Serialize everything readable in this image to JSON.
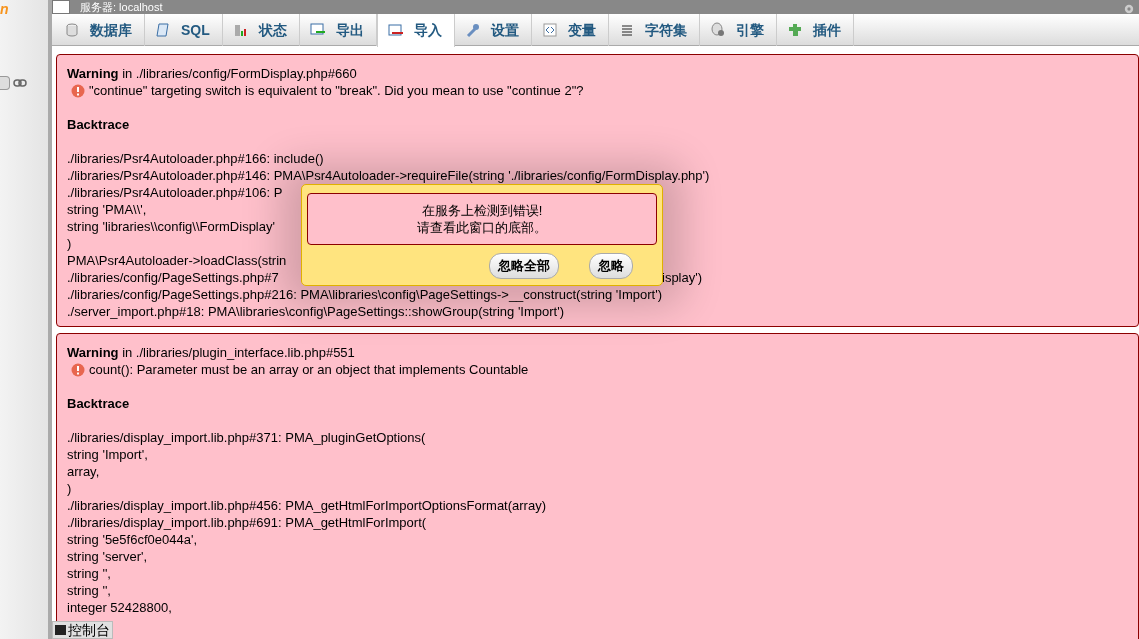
{
  "sidebar": {
    "logo_text": "n"
  },
  "window": {
    "title": "服务器: localhost"
  },
  "tabs": [
    {
      "label": "数据库",
      "selected": false
    },
    {
      "label": "SQL",
      "selected": false
    },
    {
      "label": "状态",
      "selected": false
    },
    {
      "label": "导出",
      "selected": false
    },
    {
      "label": "导入",
      "selected": true
    },
    {
      "label": "设置",
      "selected": false
    },
    {
      "label": "变量",
      "selected": false
    },
    {
      "label": "字符集",
      "selected": false
    },
    {
      "label": "引擎",
      "selected": false
    },
    {
      "label": "插件",
      "selected": false
    }
  ],
  "errors": [
    {
      "level": "Warning",
      "location": "in ./libraries/config/FormDisplay.php#660",
      "message": "\"continue\" targeting switch is equivalent to \"break\". Did you mean to use \"continue 2\"?",
      "backtrace_title": "Backtrace",
      "backtrace": [
        {
          "text": "./libraries/Psr4Autoloader.php#166: include()"
        },
        {
          "text": "./libraries/Psr4Autoloader.php#146: PMA\\Psr4Autoloader->requireFile(string './libraries/config/FormDisplay.php')"
        },
        {
          "text": "./libraries/Psr4Autoloader.php#106: P"
        },
        {
          "text": "string 'PMA\\\\',"
        },
        {
          "text": "string 'libraries\\\\config\\\\FormDisplay'"
        },
        {
          "text": ")"
        },
        {
          "text": "PMA\\Psr4Autoloader->loadClass(strin"
        },
        {
          "text": "./libraries/config/PageSettings.php#7",
          "right": "isplay')"
        },
        {
          "text": "./libraries/config/PageSettings.php#216: PMA\\libraries\\config\\PageSettings->__construct(string 'Import')"
        },
        {
          "text": "./server_import.php#18: PMA\\libraries\\config\\PageSettings::showGroup(string 'Import')"
        }
      ]
    },
    {
      "level": "Warning",
      "location": "in ./libraries/plugin_interface.lib.php#551",
      "message": "count(): Parameter must be an array or an object that implements Countable",
      "backtrace_title": "Backtrace",
      "backtrace": [
        {
          "text": "./libraries/display_import.lib.php#371: PMA_pluginGetOptions("
        },
        {
          "text": "string 'Import',"
        },
        {
          "text": "array,"
        },
        {
          "text": ")"
        },
        {
          "text": "./libraries/display_import.lib.php#456: PMA_getHtmlForImportOptionsFormat(array)"
        },
        {
          "text": "./libraries/display_import.lib.php#691: PMA_getHtmlForImport("
        },
        {
          "text": "string '5e5f6cf0e044a',"
        },
        {
          "text": "string 'server',"
        },
        {
          "text": "string '',"
        },
        {
          "text": "string '',"
        },
        {
          "text": "integer 52428800,"
        }
      ]
    }
  ],
  "dialog": {
    "lines": [
      "在服务上检测到错误!",
      "请查看此窗口的底部。"
    ],
    "buttons": [
      "忽略全部",
      "忽略"
    ]
  },
  "console": {
    "label": "控制台"
  }
}
